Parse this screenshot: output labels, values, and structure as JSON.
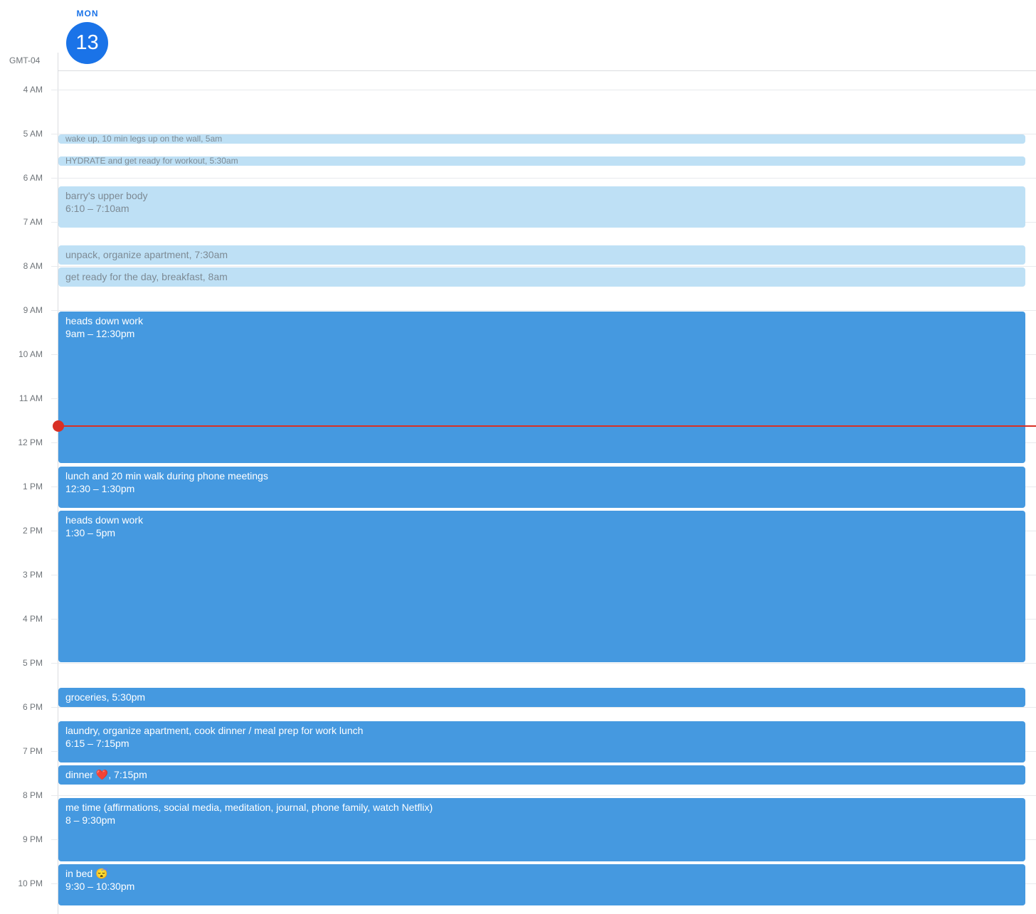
{
  "header": {
    "day_of_week": "MON",
    "day_number": "13",
    "timezone": "GMT-04"
  },
  "hours": [
    "4 AM",
    "5 AM",
    "6 AM",
    "7 AM",
    "8 AM",
    "9 AM",
    "10 AM",
    "11 AM",
    "12 PM",
    "1 PM",
    "2 PM",
    "3 PM",
    "4 PM",
    "5 PM",
    "6 PM",
    "7 PM",
    "8 PM",
    "9 PM",
    "10 PM"
  ],
  "events": [
    {
      "title": "wake up, 10 min legs up on the wall",
      "time": ", 5am"
    },
    {
      "title": "HYDRATE and get ready for workout",
      "time": ", 5:30am"
    },
    {
      "title": "barry's upper body",
      "time": "6:10 – 7:10am"
    },
    {
      "title": "unpack, organize apartment",
      "time": ", 7:30am"
    },
    {
      "title": "get ready for the day, breakfast",
      "time": ", 8am"
    },
    {
      "title": "heads down work",
      "time": "9am – 12:30pm"
    },
    {
      "title": "lunch and 20 min walk during phone meetings",
      "time": "12:30 – 1:30pm"
    },
    {
      "title": "heads down work",
      "time": "1:30 – 5pm"
    },
    {
      "title": "groceries",
      "time": ", 5:30pm"
    },
    {
      "title": "laundry, organize apartment, cook dinner / meal prep for work lunch",
      "time": "6:15 – 7:15pm"
    },
    {
      "title": "dinner",
      "emoji": "❤️",
      "time": ", 7:15pm"
    },
    {
      "title": "me time (affirmations, social media, meditation, journal, phone family, watch Netflix)",
      "time": "8 – 9:30pm"
    },
    {
      "title": "in bed",
      "emoji": "😴",
      "time": "9:30 – 10:30pm"
    }
  ],
  "colors": {
    "accent": "#1a73e8",
    "past_event": "#bee0f5",
    "event": "#4599e0",
    "now_indicator": "#d93025"
  }
}
